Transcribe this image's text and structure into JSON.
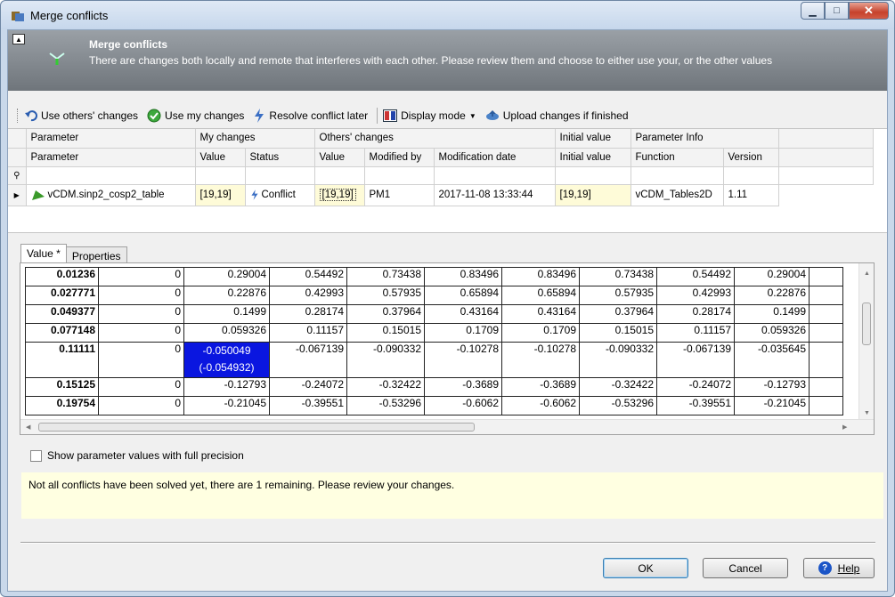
{
  "window": {
    "title": "Merge conflicts"
  },
  "banner": {
    "title": "Merge conflicts",
    "description": "There are changes both locally and remote that interferes with each other. Please review them and choose to either use your, or the other values"
  },
  "toolbar": {
    "use_others": "Use others' changes",
    "use_mine": "Use my changes",
    "resolve_later": "Resolve conflict later",
    "display_mode": "Display mode",
    "upload": "Upload changes if finished"
  },
  "grid": {
    "bands": [
      "Parameter",
      "My changes",
      "Others' changes",
      "Initial value",
      "Parameter Info"
    ],
    "columns": [
      "Parameter",
      "Value",
      "Status",
      "Value",
      "Modified by",
      "Modification date",
      "Initial value",
      "Function",
      "Version"
    ],
    "row": {
      "parameter": "vCDM.sinp2_cosp2_table",
      "my_value": "[19,19]",
      "status": "Conflict",
      "others_value": "[19,19]",
      "modified_by": "PM1",
      "modification_date": "2017-11-08 13:33:44",
      "initial_value": "[19,19]",
      "function": "vCDM_Tables2D",
      "version": "1.11"
    }
  },
  "tabs": [
    "Value *",
    "Properties"
  ],
  "values": {
    "rows": [
      {
        "h": "0.01236",
        "c": [
          "0",
          "0.29004",
          "0.54492",
          "0.73438",
          "0.83496",
          "0.83496",
          "0.73438",
          "0.54492",
          "0.29004"
        ]
      },
      {
        "h": "0.027771",
        "c": [
          "0",
          "0.22876",
          "0.42993",
          "0.57935",
          "0.65894",
          "0.65894",
          "0.57935",
          "0.42993",
          "0.22876"
        ]
      },
      {
        "h": "0.049377",
        "c": [
          "0",
          "0.1499",
          "0.28174",
          "0.37964",
          "0.43164",
          "0.43164",
          "0.37964",
          "0.28174",
          "0.1499"
        ]
      },
      {
        "h": "0.077148",
        "c": [
          "0",
          "0.059326",
          "0.11157",
          "0.15015",
          "0.1709",
          "0.1709",
          "0.15015",
          "0.11157",
          "0.059326"
        ]
      },
      {
        "h": "0.11111",
        "c": [
          "0",
          "-0.050049",
          "-0.067139",
          "-0.090332",
          "-0.10278",
          "-0.10278",
          "-0.090332",
          "-0.067139",
          "-0.035645"
        ],
        "sel_alt": "(-0.054932)"
      },
      {
        "h": "0.15125",
        "c": [
          "0",
          "-0.12793",
          "-0.24072",
          "-0.32422",
          "-0.3689",
          "-0.3689",
          "-0.32422",
          "-0.24072",
          "-0.12793"
        ]
      },
      {
        "h": "0.19754",
        "c": [
          "0",
          "-0.21045",
          "-0.39551",
          "-0.53296",
          "-0.6062",
          "-0.6062",
          "-0.53296",
          "-0.39551",
          "-0.21045"
        ]
      }
    ]
  },
  "checkbox": {
    "label": "Show parameter values with full precision"
  },
  "message": "Not all conflicts have been solved yet, there are 1 remaining. Please review your changes.",
  "buttons": {
    "ok": "OK",
    "cancel": "Cancel",
    "help": "Help"
  },
  "colors": {
    "selection": "#0a16e0",
    "message_bg": "#ffffe1",
    "highlight_cell": "#fefbd8"
  }
}
